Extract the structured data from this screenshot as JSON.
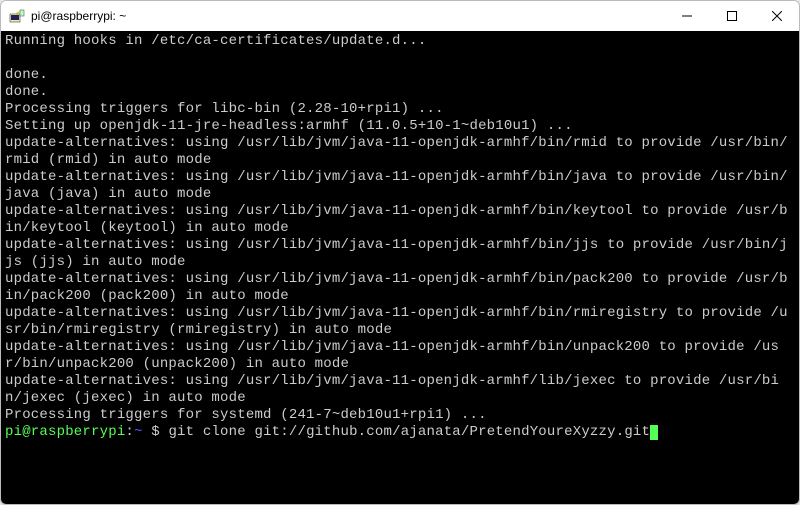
{
  "window": {
    "title": "pi@raspberrypi: ~"
  },
  "terminal": {
    "lines": [
      "Running hooks in /etc/ca-certificates/update.d...",
      "",
      "done.",
      "done.",
      "Processing triggers for libc-bin (2.28-10+rpi1) ...",
      "Setting up openjdk-11-jre-headless:armhf (11.0.5+10-1~deb10u1) ...",
      "update-alternatives: using /usr/lib/jvm/java-11-openjdk-armhf/bin/rmid to provide /usr/bin/rmid (rmid) in auto mode",
      "update-alternatives: using /usr/lib/jvm/java-11-openjdk-armhf/bin/java to provide /usr/bin/java (java) in auto mode",
      "update-alternatives: using /usr/lib/jvm/java-11-openjdk-armhf/bin/keytool to provide /usr/bin/keytool (keytool) in auto mode",
      "update-alternatives: using /usr/lib/jvm/java-11-openjdk-armhf/bin/jjs to provide /usr/bin/jjs (jjs) in auto mode",
      "update-alternatives: using /usr/lib/jvm/java-11-openjdk-armhf/bin/pack200 to provide /usr/bin/pack200 (pack200) in auto mode",
      "update-alternatives: using /usr/lib/jvm/java-11-openjdk-armhf/bin/rmiregistry to provide /usr/bin/rmiregistry (rmiregistry) in auto mode",
      "update-alternatives: using /usr/lib/jvm/java-11-openjdk-armhf/bin/unpack200 to provide /usr/bin/unpack200 (unpack200) in auto mode",
      "update-alternatives: using /usr/lib/jvm/java-11-openjdk-armhf/lib/jexec to provide /usr/bin/jexec (jexec) in auto mode",
      "Processing triggers for systemd (241-7~deb10u1+rpi1) ..."
    ],
    "prompt": {
      "user_host": "pi@raspberrypi",
      "sep": ":",
      "path": "~",
      "symbol": " $ ",
      "command": "git clone git://github.com/ajanata/PretendYoureXyzzy.git"
    }
  }
}
